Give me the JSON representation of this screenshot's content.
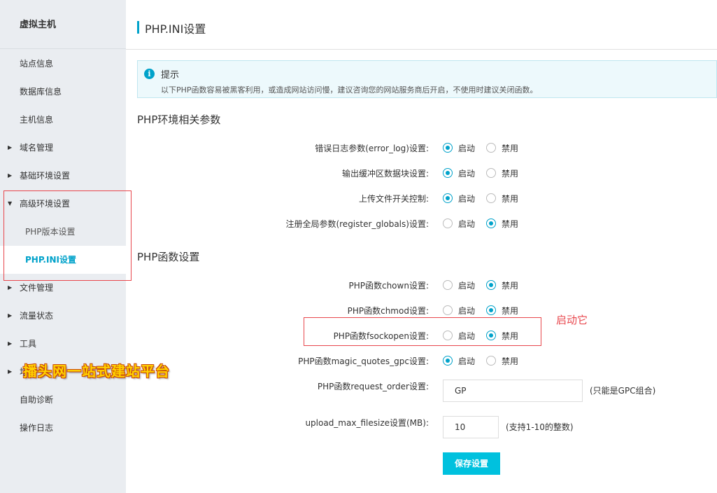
{
  "sidebar": {
    "title": "虚拟主机",
    "items": [
      {
        "label": "站点信息"
      },
      {
        "label": "数据库信息"
      },
      {
        "label": "主机信息"
      },
      {
        "label": "域名管理"
      },
      {
        "label": "基础环境设置"
      },
      {
        "label": "高级环境设置"
      },
      {
        "label": "PHP版本设置"
      },
      {
        "label": "PHP.INI设置"
      },
      {
        "label": "文件管理"
      },
      {
        "label": "流量状态"
      },
      {
        "label": "工具"
      },
      {
        "label": "增"
      },
      {
        "label": "自助诊断"
      },
      {
        "label": "操作日志"
      }
    ]
  },
  "header": {
    "title": "PHP.INI设置"
  },
  "tip": {
    "title": "提示",
    "text": "以下PHP函数容易被黑客利用，或造成网站访问慢，建议咨询您的网站服务商后开启，不使用时建议关闭函数。"
  },
  "options": {
    "enable": "启动",
    "disable": "禁用"
  },
  "env_section": {
    "title": "PHP环境相关参数",
    "rows": [
      {
        "label": "错误日志参数(error_log)设置:",
        "value": "启动"
      },
      {
        "label": "输出缓冲区数据块设置:",
        "value": "启动"
      },
      {
        "label": "上传文件开关控制:",
        "value": "启动"
      },
      {
        "label": "注册全局参数(register_globals)设置:",
        "value": "禁用"
      }
    ]
  },
  "func_section": {
    "title": "PHP函数设置",
    "rows": [
      {
        "label": "PHP函数chown设置:",
        "value": "禁用"
      },
      {
        "label": "PHP函数chmod设置:",
        "value": "禁用"
      },
      {
        "label": "PHP函数fsockopen设置:",
        "value": "禁用"
      },
      {
        "label": "PHP函数magic_quotes_gpc设置:",
        "value": "启动"
      }
    ],
    "request_order": {
      "label": "PHP函数request_order设置:",
      "value": "GP",
      "hint": "(只能是GPC组合)"
    },
    "upload_max": {
      "label": "upload_max_filesize设置(MB):",
      "value": "10",
      "hint": "(支持1-10的整数)"
    }
  },
  "save_label": "保存设置",
  "annotations": {
    "note": "启动它",
    "watermark": "播头网一站式建站平台",
    "color": "#e8474d"
  },
  "colors": {
    "accent": "#00a2ca",
    "button": "#00c1de"
  }
}
